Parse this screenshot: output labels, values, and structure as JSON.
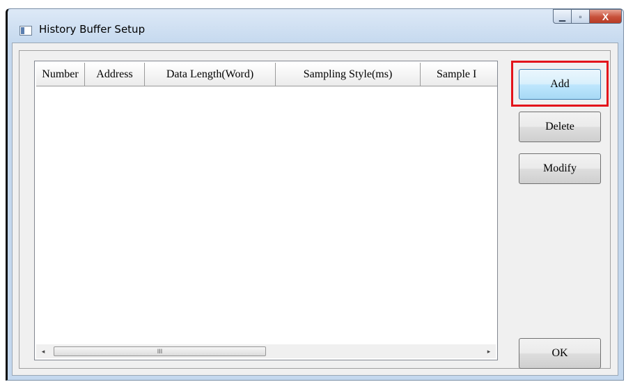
{
  "window": {
    "title": "History Buffer Setup",
    "caption_buttons": {
      "minimize_glyph": "▁",
      "maximize_glyph": "▫",
      "close_glyph": "X"
    }
  },
  "list": {
    "columns": [
      "Number",
      "Address",
      "Data Length(Word)",
      "Sampling Style(ms)",
      "Sample I"
    ],
    "rows": [],
    "scrollbar": {
      "left_arrow": "◂",
      "right_arrow": "▸",
      "grip": "III"
    }
  },
  "buttons": {
    "add": "Add",
    "delete": "Delete",
    "modify": "Modify",
    "ok": "OK"
  },
  "colors": {
    "highlight": "#e3141b",
    "close_button": "#c7503a"
  },
  "icons": [
    "app-window-icon",
    "minimize-icon",
    "maximize-icon",
    "close-icon",
    "scroll-left-icon",
    "scroll-right-icon",
    "scroll-grip-icon"
  ]
}
